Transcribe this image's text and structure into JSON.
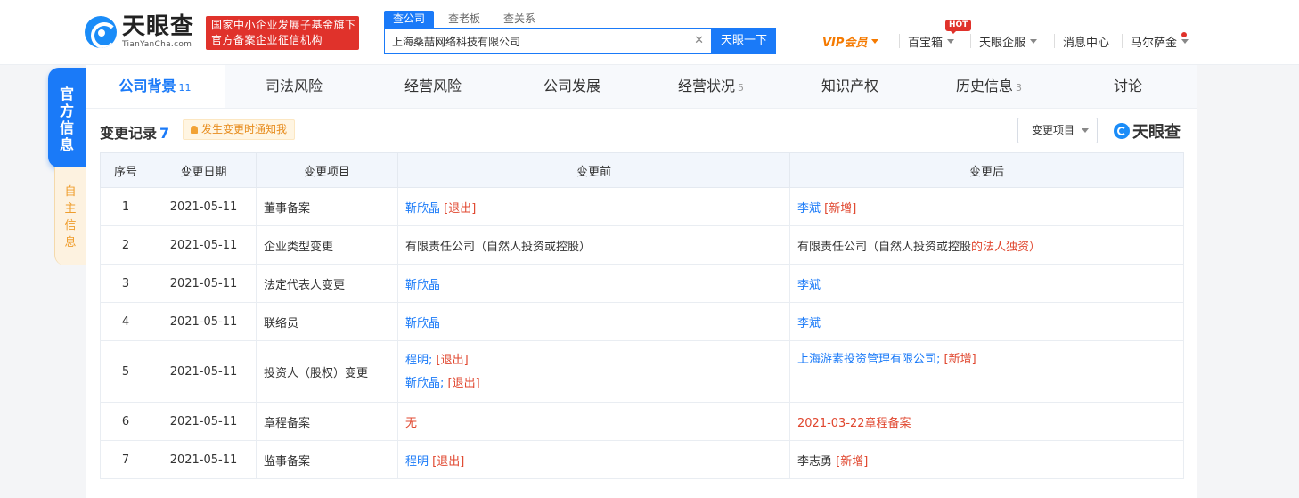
{
  "header": {
    "logo_cn": "天眼查",
    "logo_en": "TianYanCha.com",
    "banner_line1": "国家中小企业发展子基金旗下",
    "banner_line2": "官方备案企业征信机构",
    "search_tabs": [
      "查公司",
      "查老板",
      "查关系"
    ],
    "search_value": "上海桑喆网络科技有限公司",
    "search_button": "天眼一下",
    "nav": {
      "vip": "VIP会员",
      "treasure": "百宝箱",
      "hot_badge": "HOT",
      "enterprise": "天眼企服",
      "messages": "消息中心",
      "user": "马尔萨金"
    }
  },
  "side_tabs": {
    "official": "官方信息",
    "self": "自主信息"
  },
  "tabs": [
    {
      "label": "公司背景",
      "count": "11"
    },
    {
      "label": "司法风险",
      "count": ""
    },
    {
      "label": "经营风险",
      "count": ""
    },
    {
      "label": "公司发展",
      "count": ""
    },
    {
      "label": "经营状况",
      "count": "5"
    },
    {
      "label": "知识产权",
      "count": ""
    },
    {
      "label": "历史信息",
      "count": "3"
    },
    {
      "label": "讨论",
      "count": ""
    }
  ],
  "section": {
    "title": "变更记录",
    "count": "7",
    "notify_label": "发生变更时通知我",
    "filter_label": "变更项目",
    "brand": "天眼查"
  },
  "table": {
    "headers": [
      "序号",
      "变更日期",
      "变更项目",
      "变更前",
      "变更后"
    ],
    "rows": [
      {
        "no": "1",
        "date": "2021-05-11",
        "item": "董事备案",
        "before_a": "靳欣晶",
        "before_b": "[退出]",
        "after_a": "李斌",
        "after_b": "[新增]"
      },
      {
        "no": "2",
        "date": "2021-05-11",
        "item": "企业类型变更",
        "before_a": "有限责任公司（自然人投资或控股）",
        "after_a": "有限责任公司（自然人投资或控股",
        "after_b": "的法人独资）"
      },
      {
        "no": "3",
        "date": "2021-05-11",
        "item": "法定代表人变更",
        "before_a": "靳欣晶",
        "after_a": "李斌"
      },
      {
        "no": "4",
        "date": "2021-05-11",
        "item": "联络员",
        "before_a": "靳欣晶",
        "after_a": "李斌"
      },
      {
        "no": "5",
        "date": "2021-05-11",
        "item": "投资人（股权）变更",
        "before_a": "程明;",
        "before_b": "[退出]",
        "before_c": "靳欣晶;",
        "before_d": "[退出]",
        "after_a": "上海游素投资管理有限公司;",
        "after_b": "[新增]"
      },
      {
        "no": "6",
        "date": "2021-05-11",
        "item": "章程备案",
        "before_a": "无",
        "after_a": "2021-03-22章程备案"
      },
      {
        "no": "7",
        "date": "2021-05-11",
        "item": "监事备案",
        "before_a": "程明",
        "before_b": "[退出]",
        "after_a": "李志勇",
        "after_b": "[新增]"
      }
    ]
  },
  "colors": {
    "accent": "#1a7af8",
    "danger": "#e0472f",
    "vip": "#f57a00"
  }
}
